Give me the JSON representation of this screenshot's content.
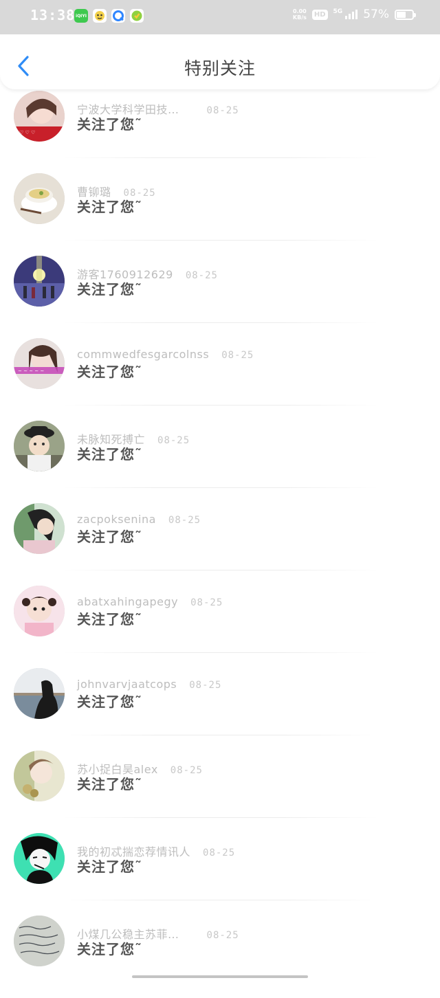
{
  "status_bar": {
    "time": "13:38",
    "net_speed_top": "0.00",
    "net_speed_unit": "KB/s",
    "hd_badge": "HD",
    "network": "5G",
    "battery_percent": "57%",
    "battery_level": 0.57,
    "app_icons": [
      {
        "icon": "iqiyi-app-icon",
        "color": "#3ec94f",
        "label": "iQIYI"
      },
      {
        "icon": "avatar-app-icon",
        "color": "#f3d14a"
      },
      {
        "icon": "qq-browser-app-icon",
        "color": "#2f86ff"
      },
      {
        "icon": "green-app-icon",
        "color": "#8fd13f"
      }
    ]
  },
  "header": {
    "title": "特别关注",
    "back_icon": "chevron-left-icon",
    "back_color": "#2f8cf6"
  },
  "items": [
    {
      "name": "宁波大学科学田技…",
      "date": "08-25",
      "action": "关注了您˜",
      "avatar": "girl-photo",
      "name_gap": 40
    },
    {
      "name": "曹铆璐",
      "date": "08-25",
      "action": "关注了您˜",
      "avatar": "pudding-photo",
      "name_gap": 18
    },
    {
      "name": "游客1760912629",
      "date": "08-25",
      "action": "关注了您˜",
      "avatar": "sunset-friends-photo",
      "name_gap": 18
    },
    {
      "name": "commwedfesgarcolnss",
      "date": "08-25",
      "action": "关注了您˜",
      "avatar": "girl-pink-text-photo",
      "name_gap": 18
    },
    {
      "name": "未脉知死搏亡",
      "date": "08-25",
      "action": "关注了您˜",
      "avatar": "child-hat-photo",
      "name_gap": 18
    },
    {
      "name": "zacpoksenina",
      "date": "08-25",
      "action": "关注了您˜",
      "avatar": "woman-dark-hair-photo",
      "name_gap": 18
    },
    {
      "name": "abatxahingapegy",
      "date": "08-25",
      "action": "关注了您˜",
      "avatar": "little-girl-photo",
      "name_gap": 18
    },
    {
      "name": "johnvarvjaatcops",
      "date": "08-25",
      "action": "关注了您˜",
      "avatar": "silhouette-lake-photo",
      "name_gap": 18
    },
    {
      "name": "苏小捉白昊alex",
      "date": "08-25",
      "action": "关注了您˜",
      "avatar": "girl-bright-photo",
      "name_gap": 18
    },
    {
      "name": "我的初忒揣恋荐情讯人",
      "date": "08-25",
      "action": "关注了您˜",
      "avatar": "anime-boy-photo",
      "name_gap": 18
    },
    {
      "name": "小煤几公稳主苏菲…",
      "date": "08-25",
      "action": "关注了您˜",
      "avatar": "handwriting-photo",
      "name_gap": 40
    }
  ]
}
